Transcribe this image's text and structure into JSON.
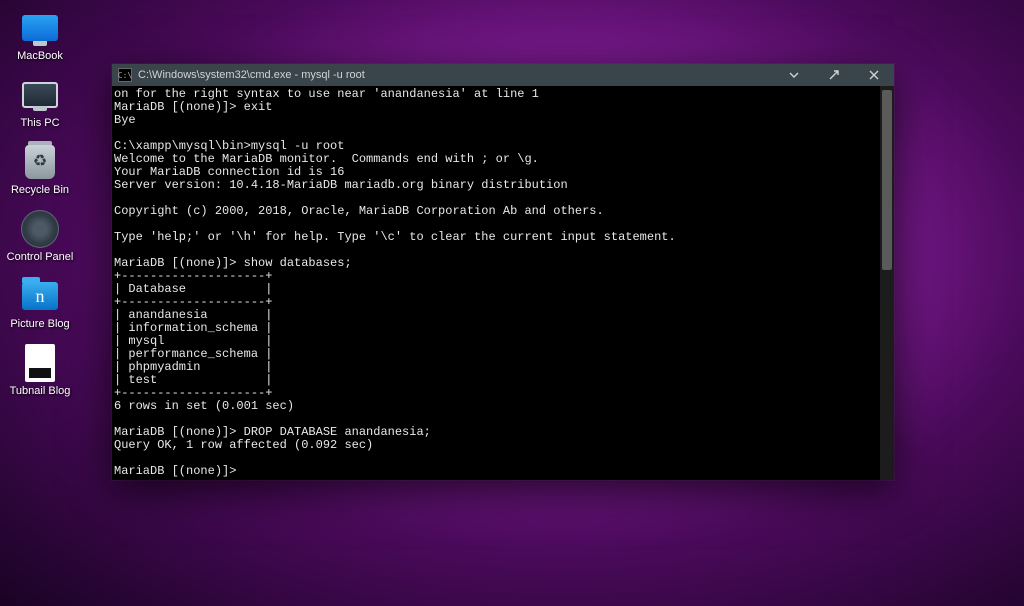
{
  "desktop": {
    "icons": [
      {
        "label": "MacBook",
        "name": "desktop-icon-macbook",
        "icon": "monitor-blue"
      },
      {
        "label": "This PC",
        "name": "desktop-icon-this-pc",
        "icon": "monitor-gray"
      },
      {
        "label": "Recycle Bin",
        "name": "desktop-icon-recycle-bin",
        "icon": "bin"
      },
      {
        "label": "Control Panel",
        "name": "desktop-icon-control-panel",
        "icon": "gear"
      },
      {
        "label": "Picture Blog",
        "name": "desktop-icon-picture-blog",
        "icon": "folder"
      },
      {
        "label": "Tubnail Blog",
        "name": "desktop-icon-tubnail-blog",
        "icon": "doc"
      }
    ]
  },
  "terminal": {
    "title": "C:\\Windows\\system32\\cmd.exe - mysql  -u root",
    "lines": [
      "on for the right syntax to use near 'anandanesia' at line 1",
      "MariaDB [(none)]> exit",
      "Bye",
      "",
      "C:\\xampp\\mysql\\bin>mysql -u root",
      "Welcome to the MariaDB monitor.  Commands end with ; or \\g.",
      "Your MariaDB connection id is 16",
      "Server version: 10.4.18-MariaDB mariadb.org binary distribution",
      "",
      "Copyright (c) 2000, 2018, Oracle, MariaDB Corporation Ab and others.",
      "",
      "Type 'help;' or '\\h' for help. Type '\\c' to clear the current input statement.",
      "",
      "MariaDB [(none)]> show databases;",
      "+--------------------+",
      "| Database           |",
      "+--------------------+",
      "| anandanesia        |",
      "| information_schema |",
      "| mysql              |",
      "| performance_schema |",
      "| phpmyadmin         |",
      "| test               |",
      "+--------------------+",
      "6 rows in set (0.001 sec)",
      "",
      "MariaDB [(none)]> DROP DATABASE anandanesia;",
      "Query OK, 1 row affected (0.092 sec)",
      "",
      "MariaDB [(none)]>"
    ]
  }
}
